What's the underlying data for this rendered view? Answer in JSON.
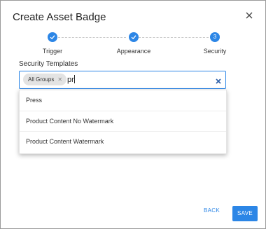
{
  "dialog": {
    "title": "Create Asset Badge",
    "close_icon": "close-icon"
  },
  "stepper": {
    "steps": [
      {
        "label": "Trigger",
        "state": "complete",
        "icon": "check-icon"
      },
      {
        "label": "Appearance",
        "state": "complete",
        "icon": "check-icon"
      },
      {
        "label": "Security",
        "state": "active",
        "number": "3"
      }
    ],
    "accent_color": "#2c86e6"
  },
  "security_templates": {
    "label": "Security Templates",
    "chips": [
      {
        "label": "All Groups",
        "remove_icon": "close-icon"
      }
    ],
    "input_value": "pr",
    "clear_icon": "clear-icon",
    "options": [
      "Press",
      "Product Content No Watermark",
      "Product Content Watermark"
    ]
  },
  "footer": {
    "back_label": "BACK",
    "save_label": "SAVE"
  }
}
